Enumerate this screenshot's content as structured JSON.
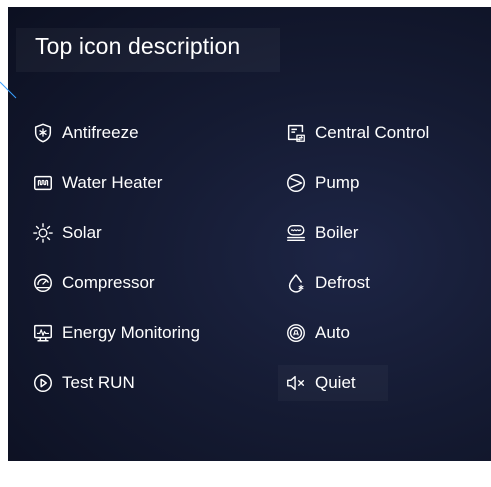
{
  "panel": {
    "title": "Top icon description"
  },
  "left_items": [
    {
      "label": "Antifreeze",
      "icon": "antifreeze-icon"
    },
    {
      "label": "Water Heater",
      "icon": "water-heater-icon"
    },
    {
      "label": "Solar",
      "icon": "solar-icon"
    },
    {
      "label": "Compressor",
      "icon": "compressor-icon"
    },
    {
      "label": "Energy Monitoring",
      "icon": "energy-monitoring-icon"
    },
    {
      "label": "Test RUN",
      "icon": "test-run-icon"
    }
  ],
  "right_items": [
    {
      "label": "Central Control",
      "icon": "central-control-icon"
    },
    {
      "label": "Pump",
      "icon": "pump-icon"
    },
    {
      "label": "Boiler",
      "icon": "boiler-icon"
    },
    {
      "label": "Defrost",
      "icon": "defrost-icon"
    },
    {
      "label": "Auto",
      "icon": "auto-icon"
    },
    {
      "label": "Quiet",
      "icon": "quiet-icon"
    }
  ],
  "colors": {
    "panel_background": "#151b33",
    "text": "#ffffff",
    "accent_line": "#3aa0ff"
  }
}
